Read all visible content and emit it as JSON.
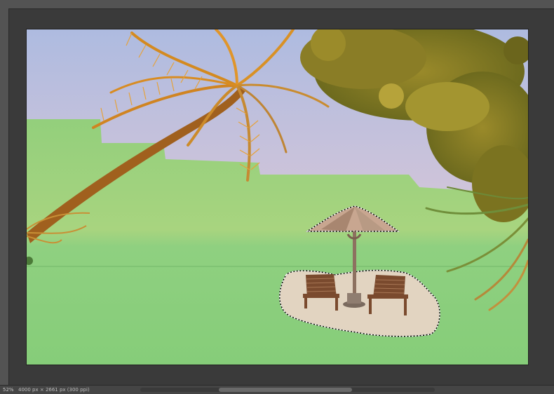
{
  "status_bar": {
    "zoom": "52%",
    "doc_info": "4000 px × 2661 px (300 ppi)"
  },
  "scene": {
    "overlay_color": "#8ed67e",
    "selection": "beach-umbrella-and-chairs"
  }
}
